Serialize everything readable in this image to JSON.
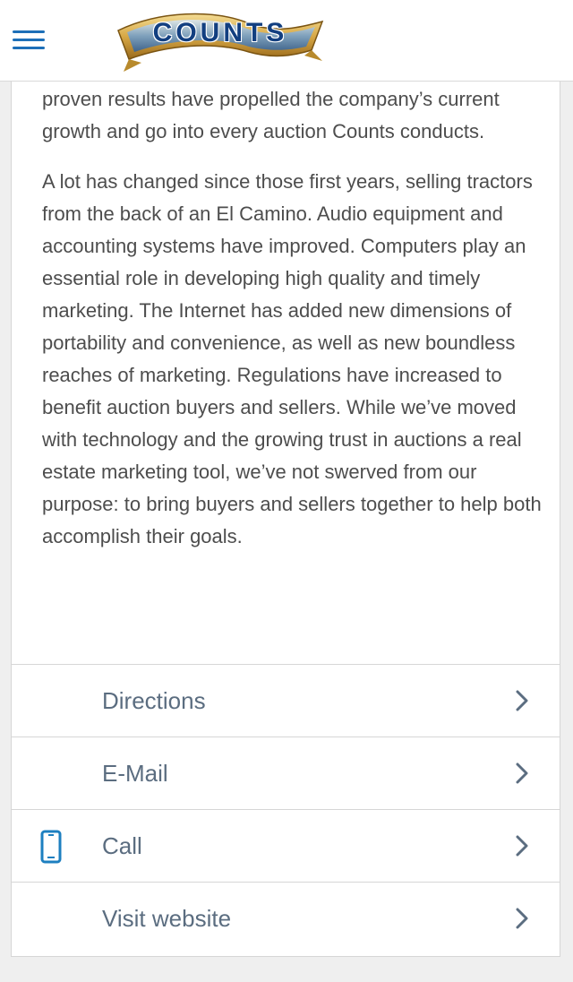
{
  "header": {
    "menu_icon": "hamburger-menu-icon",
    "logo_text": "COUNTS",
    "brand_color": "#1d6fb8"
  },
  "content": {
    "paragraphs": [
      "proven results have propelled the company’s current growth and go into every auction Counts conducts.",
      "A lot has changed since those first years, selling tractors from the back of an El Camino. Audio equipment and accounting systems have improved. Computers play an essential role in developing high quality and timely marketing. The Internet has added new dimensions of portability and convenience, as well as new boundless reaches of marketing. Regulations have increased to benefit auction buyers and sellers. While we’ve moved with technology and the growing trust in auctions a real estate marketing tool, we’ve not swerved from our purpose: to bring buyers and sellers together to help both accomplish their goals."
    ]
  },
  "actions": [
    {
      "label": "Directions",
      "icon": "chevron-right-icon"
    },
    {
      "label": "E-Mail",
      "icon": "chevron-right-icon"
    },
    {
      "label": "Call",
      "icon": "chevron-right-icon",
      "leading_icon": "phone-icon"
    },
    {
      "label": "Visit website",
      "icon": "chevron-right-icon"
    }
  ]
}
